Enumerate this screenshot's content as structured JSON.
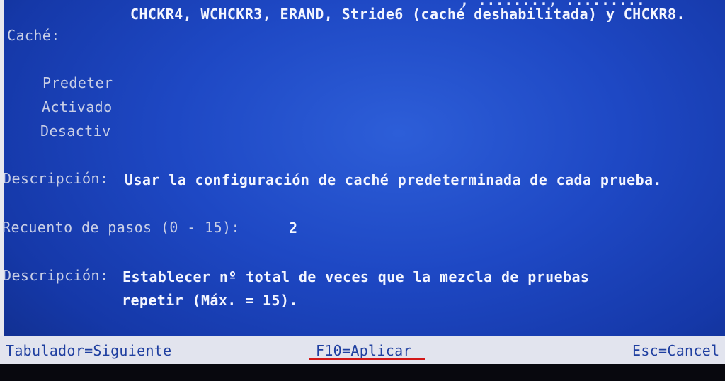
{
  "header": {
    "test_list_line": "CHCKR4, WCHCKR3, ERAND, Stride6 (caché deshabilitada) y CHCKR8."
  },
  "cache": {
    "label": "Caché:",
    "options": [
      "Predeter",
      "Activado",
      "Desactiv"
    ]
  },
  "cache_description": {
    "label": "Descripción:",
    "text": "Usar la configuración de caché predeterminada de cada prueba."
  },
  "step_count": {
    "label": "Recuento de pasos (0 - 15):",
    "value": "2"
  },
  "step_description": {
    "label": "Descripción:",
    "line1": "Establecer nº total de veces que la mezcla de pruebas",
    "line2": "repetir (Máx. = 15)."
  },
  "status_bar": {
    "tab_hint": "Tabulador=Siguiente",
    "apply_hint": "F10=Aplicar",
    "esc_hint": "Esc=Cancel"
  },
  "colors": {
    "background": "#1e48c4",
    "status_bar": "#e2e4ee",
    "status_text": "#1f3fa0",
    "highlight_underline": "#d21818"
  }
}
